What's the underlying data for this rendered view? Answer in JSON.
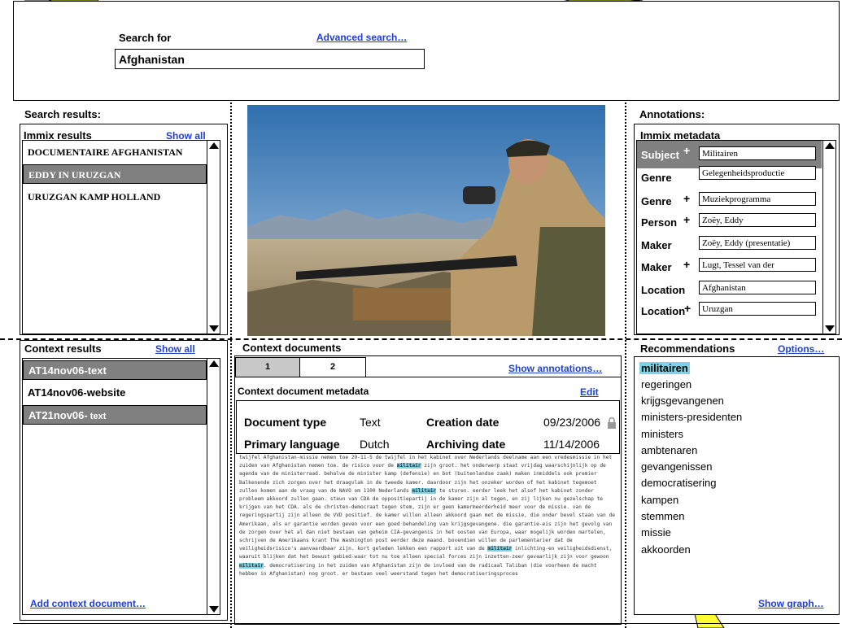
{
  "search": {
    "label": "Search for",
    "advanced_link": "Advanced search…",
    "query": "Afghanistan"
  },
  "search_results": {
    "heading": "Search results:",
    "immix_title": "Immix results",
    "show_all": "Show all",
    "items": [
      "DOCUMENTAIRE AFGHANISTAN",
      "EDDY IN URUZGAN",
      "URUZGAN KAMP HOLLAND"
    ],
    "selected_index": 1
  },
  "context_results": {
    "title": "Context results",
    "show_all": "Show all",
    "items": [
      {
        "main": "AT14nov06-text",
        "suffix": ""
      },
      {
        "main": "AT14nov06-website",
        "suffix": ""
      },
      {
        "main": "AT21nov06-",
        "suffix": " text"
      }
    ],
    "add_link": "Add context document…"
  },
  "context_documents": {
    "title": "Context documents",
    "tabs": [
      "1",
      "2"
    ],
    "active_tab": 0,
    "show_annotations": "Show annotations…",
    "metadata_title": "Context document metadata",
    "edit": "Edit",
    "doc_type_label": "Document type",
    "doc_type_value": "Text",
    "creation_label": "Creation date",
    "creation_value": "09/23/2006",
    "language_label": "Primary language",
    "language_value": "Dutch",
    "archiving_label": "Archiving date",
    "archiving_value": "11/14/2006",
    "text_segments": [
      "twijfel Afghanistan-missie nemen toe 29-11-5 de twijfel in het kabinet over Nederlands deelname aan een vredesmissie in het zuiden van Afghanistan nemen toe. de risico voor de ",
      "militair",
      " zijn groot. het onderwerp staat vrijdag waarschijnlijk op de agenda van de ministerraad. behalve de minister kamp (defensie) en bot (buitenlandse zaak) maken inmiddels ook premier Balkenende zich zorgen over het draagvlak in de tweede kamer. daardoor zijn het onzeker worden of het kabinet tegemoet zullen komen aan de vraag van de NAVO om 1100 Nederlands ",
      "militair",
      " te sturen. eerder leek het alsof het kabinet zonder probleem akkoord zullen gaan. steun van CDA de oppositiepartij in de kamer zijn al tegen, en zij lijken nu gezelschap te krijgen van het CDA. als de christen-democraat tegen stem, zijn er geen kamermeerderheid meer voor de missie. van de regeringspartij zijn alleen de VVD positief. de kamer willen alleen akkoord gaan met de missie, die onder bevel staan van de Amerikaan, als er garantie worden geven voor een goed behandeling van krijgsgevangene. die garantie-eis zijn het gevolg van de zorgen over het al dan niet bestaan van geheim CIA-gevangenis in het oosten van Europa, waar mogelijk worden martelen, schrijven de Amerikaans krant The Washington post eerder deze maand. bovendien willen de parlementarier dat de veiligheidsrisico's aanvaardbaar zijn. kort geleden lekken een rapport uit van de ",
      "militair",
      " inlichting-en veiligheidsdienst, waaruit blijken dat het bewust gebied-waar tot nu toe alleen special forces zijn inzetten-zeer gevaarlijk zijn voor gewoon ",
      "militair",
      ". democratisering in het zuiden van Afghanistan zijn de invloed van de radicaal Taliban (die voorheen de macht hebben in Afghanistan) nog groot. er bestaan veel weerstand tegen het democratiseringsproces"
    ]
  },
  "annotations": {
    "heading": "Annotations:",
    "immix_title": "Immix metadata",
    "rows": [
      {
        "label": "Subject",
        "plus": true,
        "value": "Militairen"
      },
      {
        "label": "Genre",
        "plus": false,
        "value": "Gelegenheidsproductie"
      },
      {
        "label": "Genre",
        "plus": true,
        "value": "Muziekprogramma"
      },
      {
        "label": "Person",
        "plus": true,
        "value": "Zoëy, Eddy"
      },
      {
        "label": "Maker",
        "plus": false,
        "value": "Zoëy, Eddy (presentatie)"
      },
      {
        "label": "Maker",
        "plus": true,
        "value": "Lugt, Tessel van der"
      },
      {
        "label": "Location",
        "plus": false,
        "value": "Afghanistan"
      },
      {
        "label": "Location",
        "plus": true,
        "value": "Uruzgan"
      }
    ]
  },
  "recommendations": {
    "title": "Recommendations",
    "options": "Options…",
    "items": [
      "militairen",
      "regeringen",
      "krijgsgevangenen",
      "ministers-presidenten",
      "ministers",
      "ambtenaren",
      "gevangenissen",
      "democratisering",
      "kampen",
      "stemmen",
      "missie",
      "akkoorden"
    ],
    "highlight_index": 0,
    "show_graph": "Show graph…"
  },
  "colors": {
    "callout": "#ffff33",
    "highlight": "#7fd3e6",
    "link": "#1f3fd8",
    "selected_gray": "#808080"
  }
}
